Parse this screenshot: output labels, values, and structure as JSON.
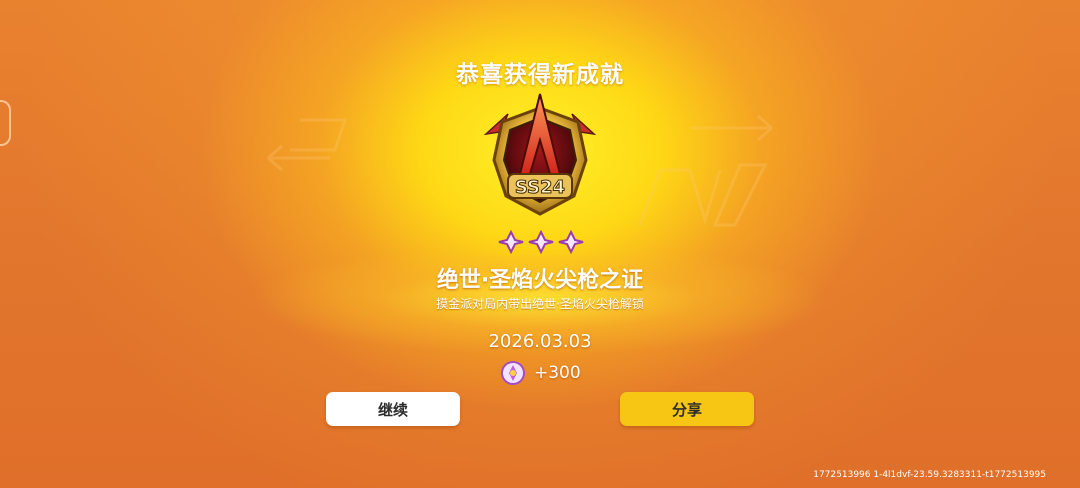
{
  "popup": {
    "title": "恭喜获得新成就",
    "badge_text": "SS24",
    "achievement_name": "绝世·圣焰火尖枪之证",
    "description": "摸金派对局内带出绝世·圣焰火尖枪解锁",
    "date": "2026.03.03",
    "reward_icon": "gem-icon",
    "reward_amount": "+300",
    "star_count": 3
  },
  "buttons": {
    "continue_label": "继续",
    "share_label": "分享"
  },
  "footer": {
    "debug_id": "1772513996  1-4l1dvf-23.59.3283311-t1772513995"
  },
  "colors": {
    "background": "#e2762d",
    "glow": "#ffe628",
    "share_button": "#f7c514",
    "continue_button": "#ffffff"
  }
}
